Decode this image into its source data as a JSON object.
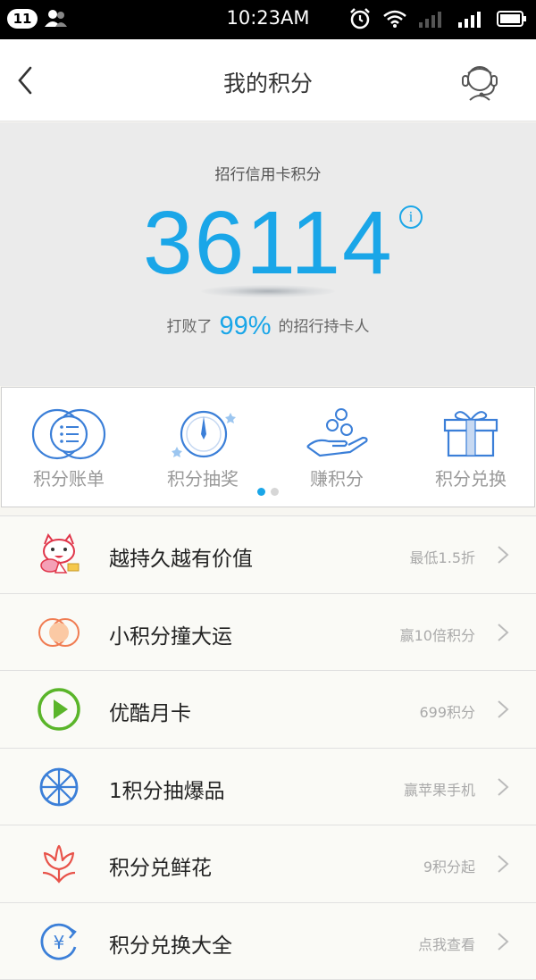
{
  "status_bar": {
    "notification_count": "11",
    "time": "10:23AM"
  },
  "nav": {
    "title": "我的积分"
  },
  "hero": {
    "label": "招行信用卡积分",
    "points": "36114",
    "info_glyph": "i",
    "rank_prefix": "打败了",
    "rank_percent": "99%",
    "rank_suffix": "的招行持卡人"
  },
  "quick_actions": [
    {
      "label": "积分账单",
      "icon": "bill-icon"
    },
    {
      "label": "积分抽奖",
      "icon": "compass-icon"
    },
    {
      "label": "赚积分",
      "icon": "coins-hand-icon"
    },
    {
      "label": "积分兑换",
      "icon": "gift-icon"
    }
  ],
  "pager": {
    "pages": 2,
    "current": 1
  },
  "list": [
    {
      "title": "越持久越有价值",
      "subtitle": "最低1.5折",
      "icon": "cat-mascot-icon"
    },
    {
      "title": "小积分撞大运",
      "subtitle": "赢10倍积分",
      "icon": "circles-icon"
    },
    {
      "title": "优酷月卡",
      "subtitle": "699积分",
      "icon": "play-icon"
    },
    {
      "title": "1积分抽爆品",
      "subtitle": "赢苹果手机",
      "icon": "wheel-icon"
    },
    {
      "title": "积分兑鲜花",
      "subtitle": "9积分起",
      "icon": "flower-icon"
    },
    {
      "title": "积分兑换大全",
      "subtitle": "点我查看",
      "icon": "yuan-cycle-icon"
    }
  ],
  "colors": {
    "accent": "#1aa6e8",
    "icon_blue": "#3b7fd8",
    "orange": "#f07c52",
    "green": "#5ab52a",
    "red": "#e8534a"
  }
}
